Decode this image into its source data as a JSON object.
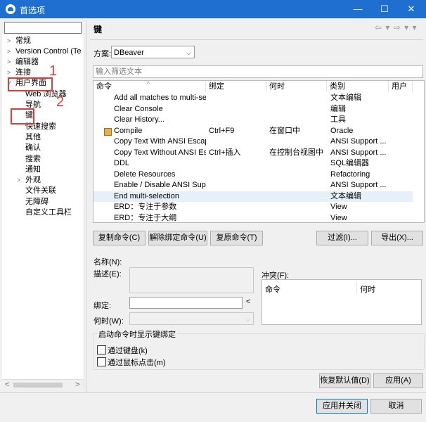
{
  "window": {
    "title": "首选项",
    "minimize": "—",
    "maximize": "☐",
    "close": "✕"
  },
  "tree": {
    "items": [
      {
        "label": "常规",
        "arrow": ">"
      },
      {
        "label": "Version Control (Te",
        "arrow": ">"
      },
      {
        "label": "编辑器",
        "arrow": ">"
      },
      {
        "label": "连接",
        "arrow": ">"
      },
      {
        "label": "用户界面",
        "arrow": "✓"
      },
      {
        "label": "Web 浏览器"
      },
      {
        "label": "导航"
      },
      {
        "label": "键"
      },
      {
        "label": "快速搜索"
      },
      {
        "label": "其他"
      },
      {
        "label": "确认"
      },
      {
        "label": "搜索"
      },
      {
        "label": "通知"
      },
      {
        "label": "外观",
        "arrow": ">"
      },
      {
        "label": "文件关联"
      },
      {
        "label": "无障碍"
      },
      {
        "label": "自定义工具栏"
      }
    ],
    "scroll_left": "<",
    "scroll_right": ">"
  },
  "annotations": {
    "num1": "1",
    "num2": "2"
  },
  "page": {
    "title": "键",
    "scheme_label": "方案:",
    "scheme_value": "DBeaver",
    "filter_placeholder": "输入筛选文本",
    "table": {
      "headers": {
        "command": "命令",
        "binding": "绑定",
        "when": "何时",
        "category": "类别",
        "user": "用户"
      },
      "rows": [
        {
          "command": "Add all matches to multi-se",
          "binding": "",
          "when": "",
          "category": "文本编辑"
        },
        {
          "command": "Clear Console",
          "binding": "",
          "when": "",
          "category": "编辑"
        },
        {
          "command": "Clear History...",
          "binding": "",
          "when": "",
          "category": "工具"
        },
        {
          "command": "Compile",
          "binding": "Ctrl+F9",
          "when": "在窗口中",
          "category": "Oracle",
          "icon": true
        },
        {
          "command": "Copy Text With ANSI Escap",
          "binding": "",
          "when": "",
          "category": "ANSI Support ..."
        },
        {
          "command": "Copy Text Without ANSI Es",
          "binding": "Ctrl+插入",
          "when": "在控制台视图中",
          "category": "ANSI Support ..."
        },
        {
          "command": "DDL",
          "binding": "",
          "when": "",
          "category": "SQL编辑器"
        },
        {
          "command": "Delete Resources",
          "binding": "",
          "when": "",
          "category": "Refactoring"
        },
        {
          "command": "Enable / Disable ANSI Supp",
          "binding": "",
          "when": "",
          "category": "ANSI Support ..."
        },
        {
          "command": "End multi-selection",
          "binding": "",
          "when": "",
          "category": "文本编辑",
          "selected": true
        },
        {
          "command": "ERD：专注于参数",
          "binding": "",
          "when": "",
          "category": "View"
        },
        {
          "command": "ERD：专注于大纲",
          "binding": "",
          "when": "",
          "category": "View"
        }
      ]
    },
    "buttons": {
      "copy": "复制命令(C)",
      "unbind": "解除绑定命令(U)",
      "restore": "复原命令(T)",
      "filters": "过滤(I)...",
      "export": "导出(X)..."
    },
    "details": {
      "name_label": "名称(N):",
      "desc_label": "描述(E):",
      "binding_label": "绑定:",
      "binding_arrow": "<",
      "when_label": "何时(W):",
      "conflicts_label": "冲突(F):",
      "conflict_col_command": "命令",
      "conflict_col_when": "何时"
    },
    "group": {
      "title": "启动命令时显示键绑定",
      "keyboard": "通过键盘(k)",
      "mouse": "通过鼠标点击(m)"
    },
    "restore_defaults": "恢复默认值(D)",
    "apply": "应用(A)",
    "apply_close": "应用并关闭",
    "cancel": "取消"
  },
  "nav_icons": "⇦ ▾ ⇨ ▾ ▾"
}
